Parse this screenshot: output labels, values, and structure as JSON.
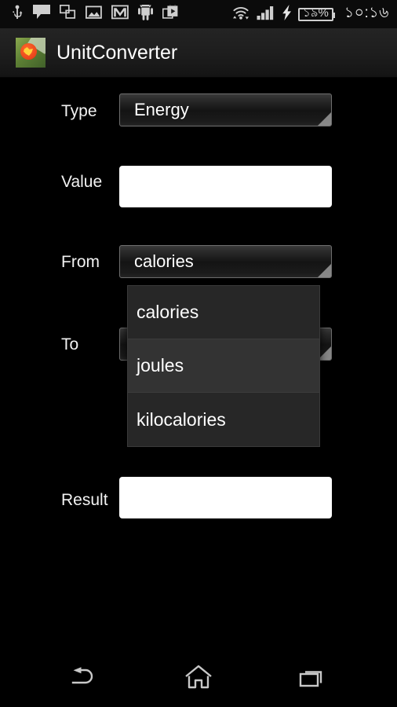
{
  "status_bar": {
    "left_icons": [
      {
        "name": "usb-icon",
        "label": "USB"
      },
      {
        "name": "sms-message-icon",
        "label": "Message"
      },
      {
        "name": "screenshot-copy-icon",
        "label": "Screenshot"
      },
      {
        "name": "gallery-image-icon",
        "label": "Gallery"
      },
      {
        "name": "gmail-icon",
        "label": "Gmail"
      },
      {
        "name": "android-icon",
        "label": "Android"
      },
      {
        "name": "play-store-icon",
        "label": "Play Store"
      }
    ],
    "wifi_icon": "wifi-icon",
    "signal_icon": "cellular-signal-icon",
    "charging_icon": "charging-bolt-icon",
    "battery_percent": "১৯%",
    "clock": "১০:১৬"
  },
  "title_bar": {
    "app_icon": "app-launcher-icon",
    "title": "UnitConverter"
  },
  "form": {
    "rows": [
      {
        "label": "Type",
        "widget": "spinner",
        "value": "Energy"
      },
      {
        "label": "Value",
        "widget": "edittext",
        "value": "",
        "placeholder": ""
      },
      {
        "label": "From",
        "widget": "spinner",
        "value": "calories"
      },
      {
        "label": "To",
        "widget": "spinner",
        "value": "joules"
      },
      {
        "label": "Result",
        "widget": "edittext",
        "value": "",
        "placeholder": ""
      }
    ]
  },
  "dropdown": {
    "open": true,
    "anchor": "From",
    "items": [
      {
        "label": "calories",
        "selected": false
      },
      {
        "label": "joules",
        "selected": true
      },
      {
        "label": "kilocalories",
        "selected": false
      }
    ]
  },
  "nav_bar": {
    "buttons": [
      {
        "name": "back-button",
        "label": "Back"
      },
      {
        "name": "home-button",
        "label": "Home"
      },
      {
        "name": "recents-button",
        "label": "Recent apps"
      }
    ]
  },
  "colors": {
    "background": "#000000",
    "title_bar": "#1d1d1d",
    "spinner_border": "#6e6e6e",
    "dropdown_bg": "#272727",
    "text": "#ffffff",
    "icon": "#cfcfcf"
  }
}
